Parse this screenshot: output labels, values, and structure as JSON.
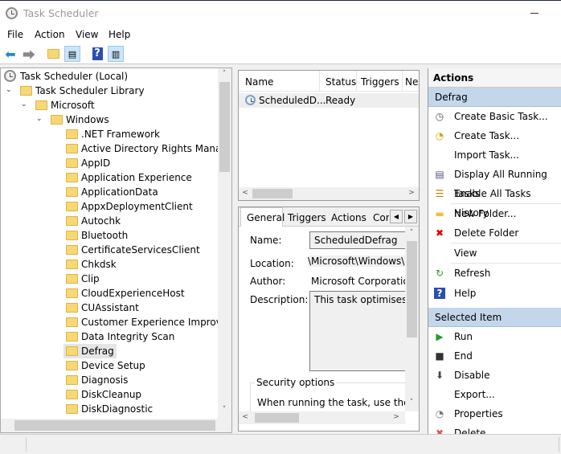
{
  "window": {
    "title": "Task Scheduler"
  },
  "menu": [
    "File",
    "Action",
    "View",
    "Help"
  ],
  "toolbar": {
    "icons": [
      "back-arrow-icon",
      "forward-arrow-icon",
      "up-folder-icon",
      "show-hide-console-tree-icon",
      "help-icon",
      "show-hide-action-pane-icon"
    ]
  },
  "tree": {
    "root": "Task Scheduler (Local)",
    "library": "Task Scheduler Library",
    "microsoft": "Microsoft",
    "windows": "Windows",
    "children": [
      ".NET Framework",
      "Active Directory Rights Management",
      "AppID",
      "Application Experience",
      "ApplicationData",
      "AppxDeploymentClient",
      "Autochk",
      "Bluetooth",
      "CertificateServicesClient",
      "Chkdsk",
      "Clip",
      "CloudExperienceHost",
      "CUAssistant",
      "Customer Experience Improvement Program",
      "Data Integrity Scan",
      "Defrag",
      "Device Setup",
      "Diagnosis",
      "DiskCleanup",
      "DiskDiagnostic"
    ],
    "selected": "Defrag"
  },
  "tasklist": {
    "columns": [
      "Name",
      "Status",
      "Triggers",
      "Next Run Time"
    ],
    "rows": [
      {
        "name": "ScheduledD...",
        "status": "Ready"
      }
    ]
  },
  "details": {
    "tabs": [
      "General",
      "Triggers",
      "Actions",
      "Conditions"
    ],
    "active_tab": "General",
    "name_label": "Name:",
    "name_value": "ScheduledDefrag",
    "location_label": "Location:",
    "location_value": "\\Microsoft\\Windows\\Defrag",
    "author_label": "Author:",
    "author_value": "Microsoft Corporation",
    "description_label": "Description:",
    "description_value": "This task optimises local storage drives.",
    "security_title": "Security options",
    "security_text": "When running the task, use the following user account:"
  },
  "actions": {
    "header": "Actions",
    "section1": "Defrag",
    "items1": [
      "Create Basic Task...",
      "Create Task...",
      "Import Task...",
      "Display All Running Tasks",
      "Enable All Tasks History",
      "New Folder...",
      "Delete Folder",
      "View",
      "Refresh",
      "Help"
    ],
    "section2": "Selected Item",
    "items2": [
      "Run",
      "End",
      "Disable",
      "Export...",
      "Properties",
      "Delete"
    ]
  },
  "colors": {
    "section_bg": "#c4d6ea",
    "selection": "#e5e5e5"
  }
}
